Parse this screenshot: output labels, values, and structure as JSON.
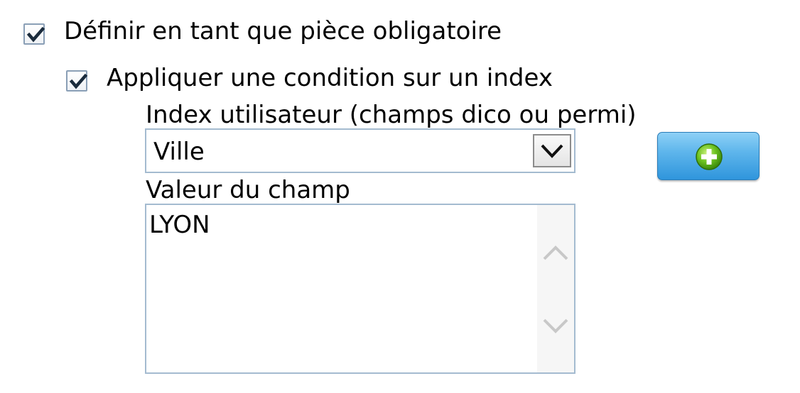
{
  "mandatory_checkbox": {
    "label": "Définir en tant que pièce obligatoire",
    "checked": true
  },
  "condition_checkbox": {
    "label": "Appliquer une condition sur un index",
    "checked": true
  },
  "index_field": {
    "label": "Index utilisateur (champs dico ou permi)",
    "selected_value": "Ville"
  },
  "value_field": {
    "label": "Valeur du champ",
    "value": "LYON"
  },
  "icons": {
    "checkbox_mark": "check-icon",
    "dropdown": "chevron-down-icon",
    "add": "plus-circle-icon",
    "scroll_up": "chevron-up-icon",
    "scroll_down": "chevron-down-icon"
  },
  "colors": {
    "field_border": "#a4bbd0",
    "button_blue": "#2f95dc",
    "add_icon_green": "#6cc21f",
    "checkbox_border": "#8a9fb6"
  }
}
